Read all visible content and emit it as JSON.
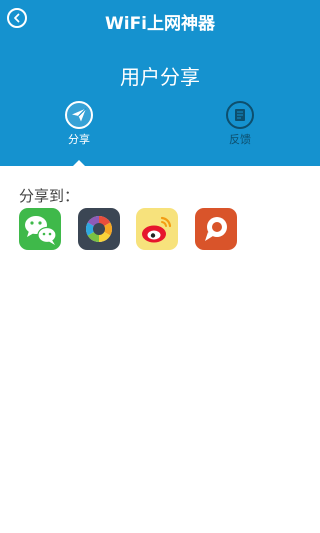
{
  "header": {
    "app_title": "WiFi上网神器",
    "page_title": "用户分享",
    "tabs": [
      {
        "label": "分享",
        "icon": "paper-plane-icon",
        "active": true
      },
      {
        "label": "反馈",
        "icon": "document-icon",
        "active": false
      }
    ]
  },
  "share": {
    "label": "分享到：",
    "apps": [
      {
        "icon": "wechat-icon"
      },
      {
        "icon": "moments-icon"
      },
      {
        "icon": "weibo-icon"
      },
      {
        "icon": "share-app-icon"
      }
    ]
  },
  "colors": {
    "header_bg": "#1592cf",
    "inactive_tab": "#0d4f6e",
    "body_bg": "#ffffff"
  }
}
